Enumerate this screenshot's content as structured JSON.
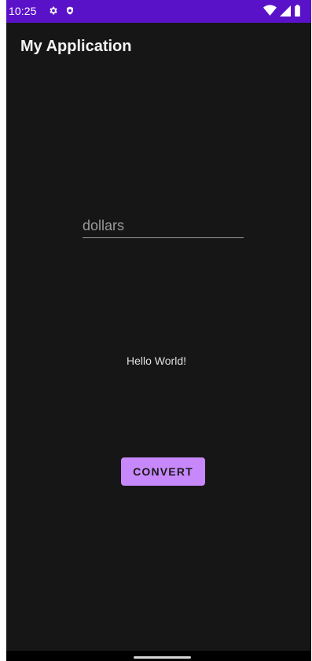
{
  "status_bar": {
    "time": "10:25",
    "left_icons": [
      "gear-icon",
      "shield-icon"
    ],
    "right_icons": [
      "wifi-icon",
      "cellular-signal-icon",
      "battery-icon"
    ]
  },
  "app": {
    "title": "My Application"
  },
  "form": {
    "dollars_placeholder": "dollars",
    "dollars_value": "",
    "hello_text": "Hello World!",
    "convert_label": "CONVERT"
  },
  "colors": {
    "status_bar": "#5a12c9",
    "background": "#161616",
    "button": "#c788fb"
  }
}
